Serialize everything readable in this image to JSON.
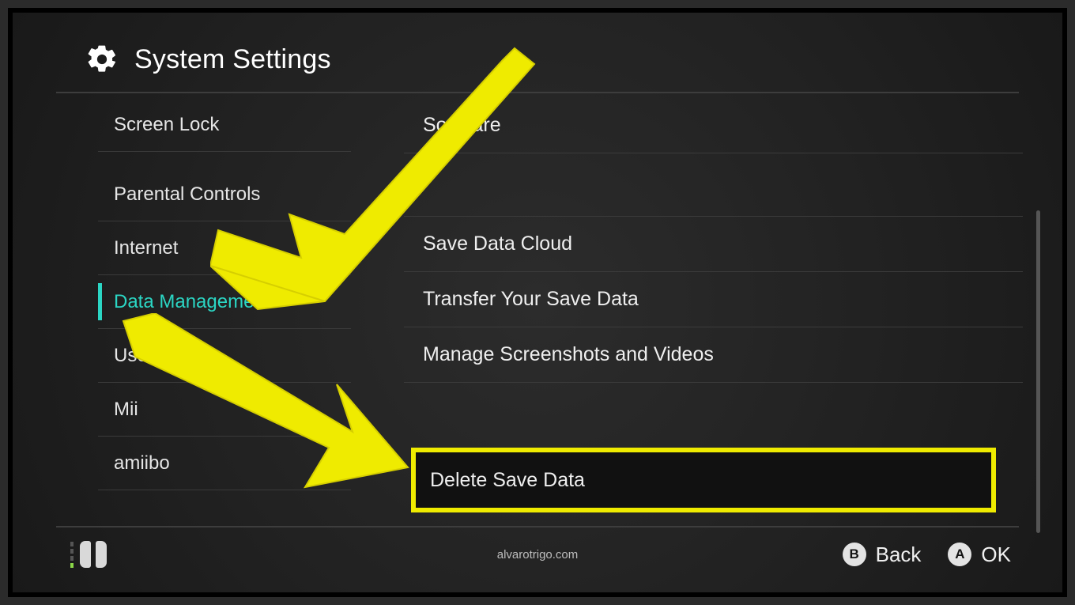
{
  "header": {
    "title": "System Settings"
  },
  "sidebar": {
    "items": [
      {
        "label": "Screen Lock",
        "selected": false
      },
      {
        "label": "Parental Controls",
        "selected": false
      },
      {
        "label": "Internet",
        "selected": false
      },
      {
        "label": "Data Management",
        "selected": true
      },
      {
        "label": "User",
        "selected": false
      },
      {
        "label": "Mii",
        "selected": false
      },
      {
        "label": "amiibo",
        "selected": false
      }
    ]
  },
  "main": {
    "items": [
      {
        "label": "Software"
      },
      {
        "label": "Save Data Cloud"
      },
      {
        "label": "Transfer Your Save Data"
      },
      {
        "label": "Manage Screenshots and Videos"
      },
      {
        "label": "Delete Save Data"
      }
    ]
  },
  "footer": {
    "watermark": "alvarotrigo.com",
    "hints": [
      {
        "button": "B",
        "label": "Back"
      },
      {
        "button": "A",
        "label": "OK"
      }
    ]
  },
  "annotation": {
    "highlight_color": "#efeb00",
    "arrows": 2,
    "highlighted_item": "Delete Save Data"
  }
}
